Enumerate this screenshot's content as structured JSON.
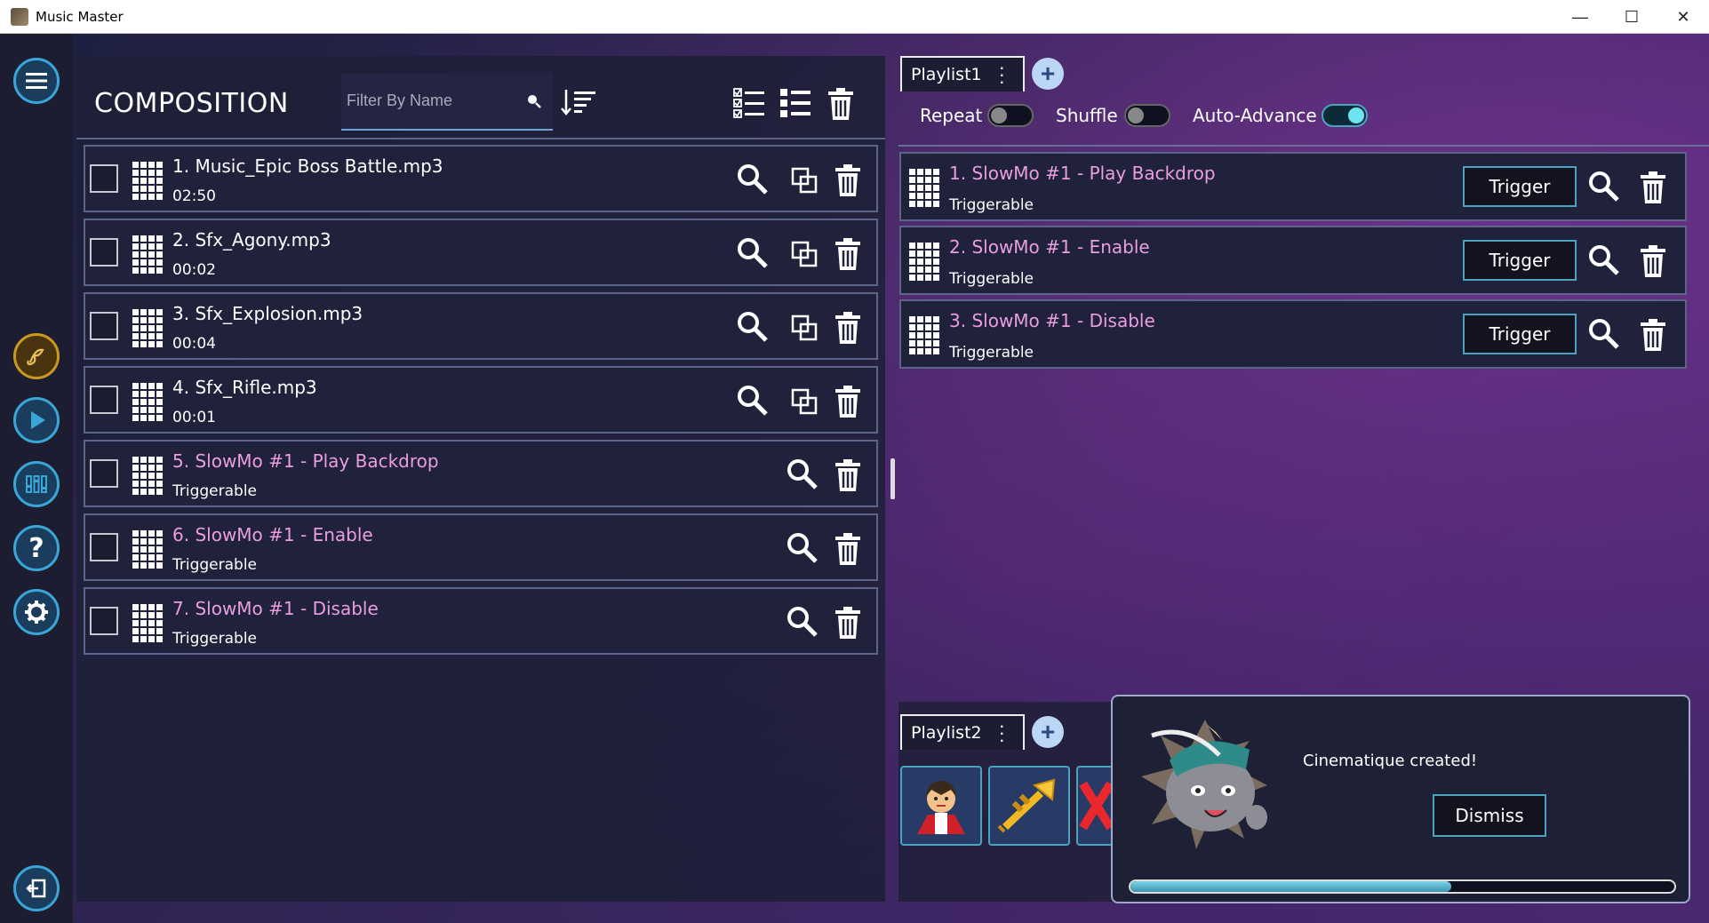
{
  "window": {
    "title": "Music Master",
    "controls": {
      "minimize": "—",
      "maximize": "☐",
      "close": "✕"
    }
  },
  "sidebar": {
    "items": [
      {
        "name": "menu-icon"
      },
      {
        "name": "music-library-icon"
      },
      {
        "name": "play-icon"
      },
      {
        "name": "mixer-icon"
      },
      {
        "name": "help-icon"
      },
      {
        "name": "settings-icon"
      },
      {
        "name": "exit-icon"
      }
    ]
  },
  "composition": {
    "title": "COMPOSITION",
    "filter_placeholder": "Filter By Name",
    "items": [
      {
        "index": "1.",
        "name": "Music_Epic Boss Battle.mp3",
        "sub": "02:50",
        "kind": "audio"
      },
      {
        "index": "2.",
        "name": "Sfx_Agony.mp3",
        "sub": "00:02",
        "kind": "audio"
      },
      {
        "index": "3.",
        "name": "Sfx_Explosion.mp3",
        "sub": "00:04",
        "kind": "audio"
      },
      {
        "index": "4.",
        "name": "Sfx_Rifle.mp3",
        "sub": "00:01",
        "kind": "audio"
      },
      {
        "index": "5.",
        "name": "SlowMo #1 - Play Backdrop",
        "sub": "Triggerable",
        "kind": "trigger"
      },
      {
        "index": "6.",
        "name": "SlowMo #1 - Enable",
        "sub": "Triggerable",
        "kind": "trigger"
      },
      {
        "index": "7.",
        "name": "SlowMo #1 - Disable",
        "sub": "Triggerable",
        "kind": "trigger"
      }
    ]
  },
  "playlist1": {
    "tab_label": "Playlist1",
    "toggles": [
      {
        "label": "Repeat",
        "on": false
      },
      {
        "label": "Shuffle",
        "on": false
      },
      {
        "label": "Auto-Advance",
        "on": true
      }
    ],
    "items": [
      {
        "index": "1.",
        "name": "SlowMo #1 - Play Backdrop",
        "sub": "Triggerable",
        "button": "Trigger"
      },
      {
        "index": "2.",
        "name": "SlowMo #1 - Enable",
        "sub": "Triggerable",
        "button": "Trigger"
      },
      {
        "index": "3.",
        "name": "SlowMo #1 - Disable",
        "sub": "Triggerable",
        "button": "Trigger"
      }
    ]
  },
  "playlist2": {
    "tab_label": "Playlist2",
    "tiles": [
      {
        "name": "vampire-icon"
      },
      {
        "name": "trumpet-icon"
      },
      {
        "name": "red-x-icon"
      }
    ]
  },
  "toast": {
    "message": "Cinematique created!",
    "dismiss_label": "Dismiss",
    "progress": 0.59
  },
  "colors": {
    "accent": "#4aa4c0",
    "pink": "#ea9ee0",
    "panel": "#20223b",
    "gold": "#c99a1d"
  }
}
